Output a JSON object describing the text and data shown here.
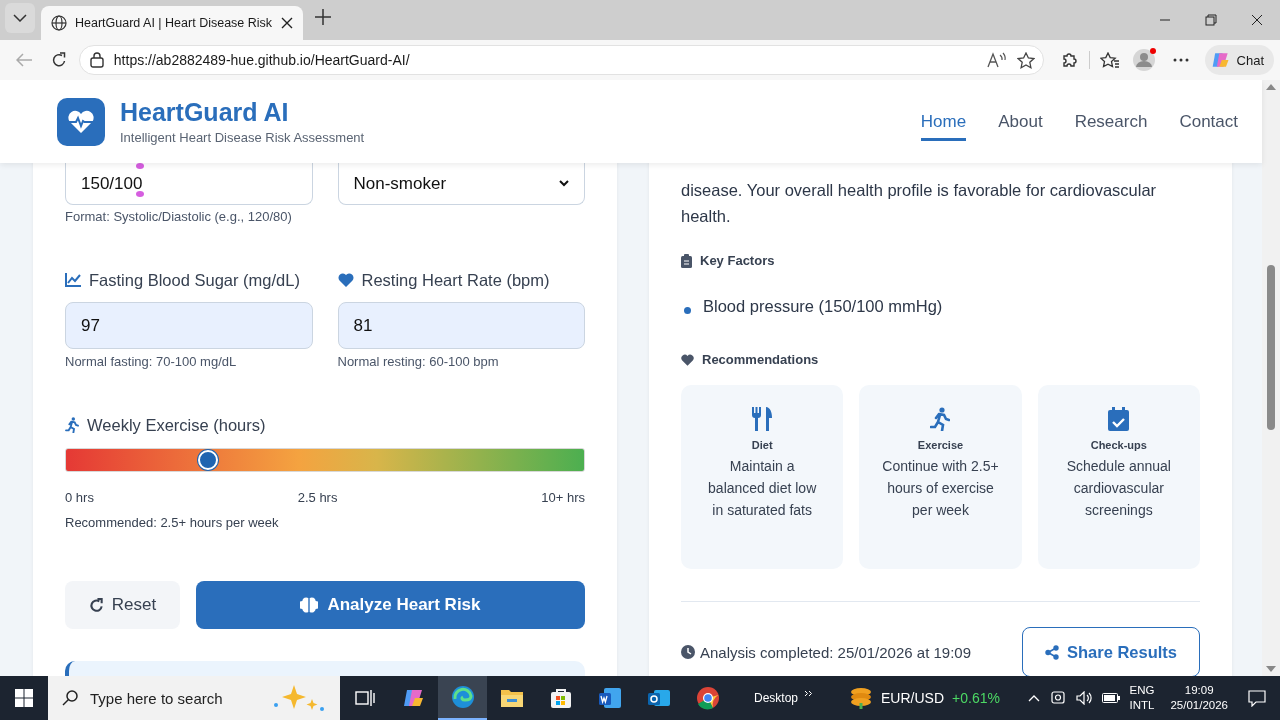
{
  "browser": {
    "tabs": [
      {
        "title": "HeartGuard AI | Heart Disease Risk",
        "selected": true
      }
    ],
    "url": "https://ab2882489-hue.github.io/HeartGuard-AI/",
    "chat_label": "Chat"
  },
  "header": {
    "title": "HeartGuard AI",
    "subtitle": "Intelligent Heart Disease Risk Assessment",
    "nav": [
      {
        "label": "Home",
        "selected": true
      },
      {
        "label": "About",
        "selected": false
      },
      {
        "label": "Research",
        "selected": false
      },
      {
        "label": "Contact",
        "selected": false
      }
    ]
  },
  "form": {
    "pressure": {
      "value": "150/100",
      "hint": "Format: Systolic/Diastolic (e.g., 120/80)"
    },
    "smoking": {
      "value": "Non-smoker"
    },
    "vitals": [
      {
        "label": "Fasting Blood Sugar (mg/dL)",
        "value": "97",
        "hint": "Normal fasting: 70-100 mg/dL"
      },
      {
        "label": "Resting Heart Rate (bpm)",
        "value": "81",
        "hint": "Normal resting: 60-100 bpm"
      }
    ],
    "exercise": {
      "label": "Weekly Exercise (hours)",
      "level": 0.275,
      "scale": [
        "0 hrs",
        "2.5 hrs",
        "10+ hrs"
      ],
      "note": "Recommended: 2.5+ hours per week"
    },
    "reset_label": "Reset",
    "analyze_label": "Analyze Heart Risk"
  },
  "results": {
    "summary": "disease. Your overall health profile is favorable for cardiovascular health.",
    "key_factors_title": "Key Factors",
    "key_factors": [
      "Blood pressure (150/100 mmHg)"
    ],
    "recommendations_title": "Recommendations",
    "recommendations": [
      {
        "title": "Diet",
        "text": "Maintain a balanced diet low in saturated fats"
      },
      {
        "title": "Exercise",
        "text": "Continue with 2.5+ hours of exercise per week"
      },
      {
        "title": "Check-ups",
        "text": "Schedule annual cardiovascular screenings"
      }
    ],
    "completed": "Analysis completed: 25/01/2026 at 19:09",
    "share_label": "Share Results"
  },
  "taskbar": {
    "search_placeholder": "Type here to search",
    "apps": [
      {
        "selected": false
      },
      {
        "selected": false
      },
      {
        "selected": true
      },
      {
        "selected": false
      },
      {
        "selected": false
      },
      {
        "selected": false
      },
      {
        "selected": false
      },
      {
        "selected": false
      }
    ],
    "desktop_label": "Desktop",
    "ticker_name": "EUR/USD",
    "ticker_change": "+0.61%",
    "language": [
      "ENG",
      "INTL"
    ],
    "time": "19:09",
    "date": "25/01/2026"
  }
}
